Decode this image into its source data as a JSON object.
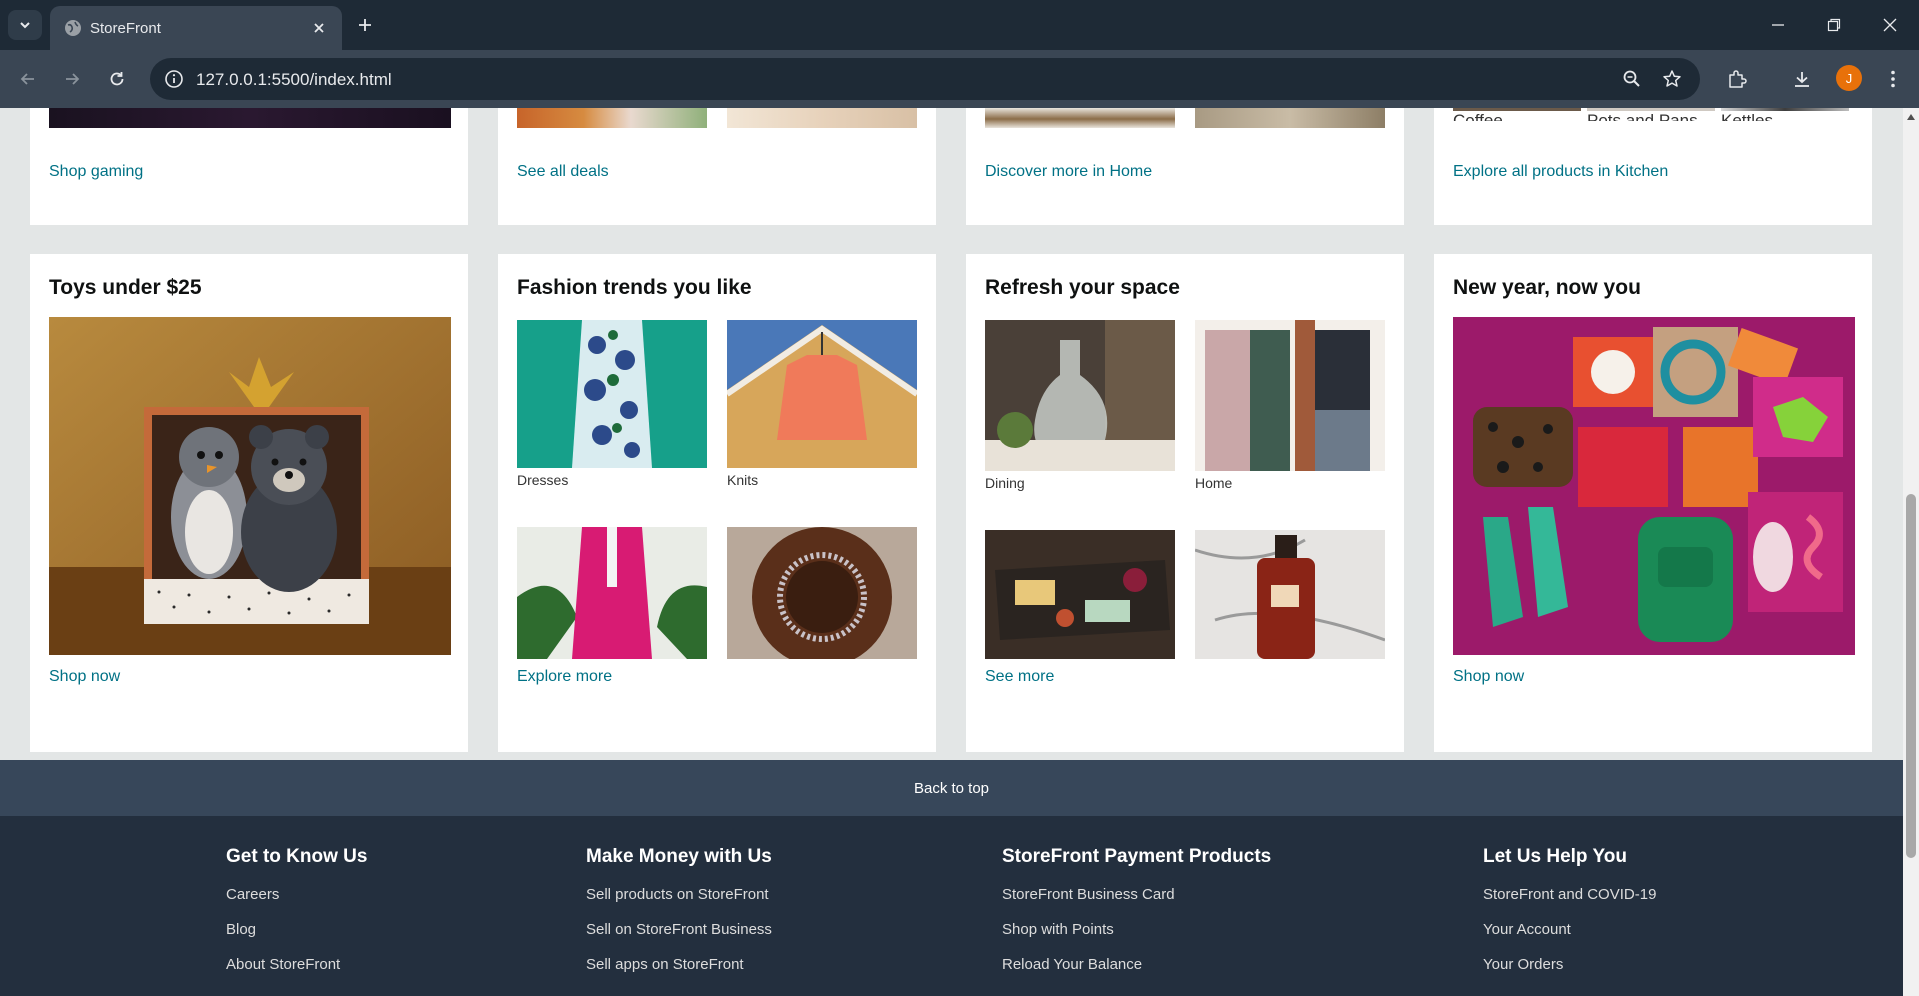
{
  "browser": {
    "tab_title": "StoreFront",
    "url": "127.0.0.1:5500/index.html",
    "profile_initial": "J"
  },
  "top_row": [
    {
      "link": "Shop gaming"
    },
    {
      "link": "See all deals"
    },
    {
      "link": "Discover more in Home"
    },
    {
      "link": "Explore all products in Kitchen",
      "captions": [
        "Coffee",
        "Pots and Pans",
        "Kettles"
      ]
    }
  ],
  "cards": [
    {
      "title": "Toys under $25",
      "link": "Shop now"
    },
    {
      "title": "Fashion trends you like",
      "link": "Explore more",
      "captions": [
        "Dresses",
        "Knits"
      ]
    },
    {
      "title": "Refresh your space",
      "link": "See more",
      "captions": [
        "Dining",
        "Home"
      ]
    },
    {
      "title": "New year, now you",
      "link": "Shop now"
    }
  ],
  "footer": {
    "back_to_top": "Back to top",
    "columns": [
      {
        "heading": "Get to Know Us",
        "links": [
          "Careers",
          "Blog",
          "About StoreFront"
        ]
      },
      {
        "heading": "Make Money with Us",
        "links": [
          "Sell products on StoreFront",
          "Sell on StoreFront Business",
          "Sell apps on StoreFront"
        ]
      },
      {
        "heading": "StoreFront Payment Products",
        "links": [
          "StoreFront Business Card",
          "Shop with Points",
          "Reload Your Balance"
        ]
      },
      {
        "heading": "Let Us Help You",
        "links": [
          "StoreFront and COVID-19",
          "Your Account",
          "Your Orders"
        ]
      }
    ]
  },
  "colors": {
    "link": "#007185",
    "page_bg": "#e3e6e6",
    "footer_bg": "#232f3e",
    "footer_top_bg": "#37475a"
  }
}
